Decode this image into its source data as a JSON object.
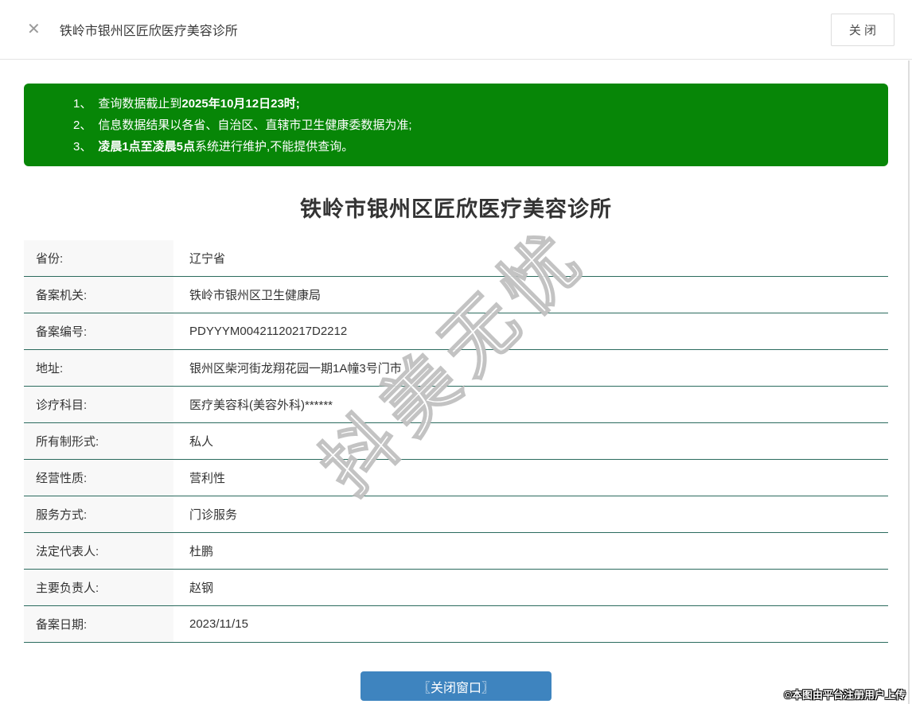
{
  "header": {
    "title": "铁岭市银州区匠欣医疗美容诊所",
    "close_button_label": "关 闭"
  },
  "icons": {
    "close_x": "✕"
  },
  "notice": {
    "line1_num": "1、",
    "line1_text": "查询数据截止到",
    "line1_bold": "2025年10月12日23时",
    "line1_end": ";",
    "line2_num": "2、",
    "line2_text": "信息数据结果以各省、自治区、直辖市卫生健康委数据为准;",
    "line3_num": "3、",
    "line3_bold": "凌晨1点至凌晨5点",
    "line3_text": "系统进行维护,不能提供查询。"
  },
  "main": {
    "title": "铁岭市银州区匠欣医疗美容诊所"
  },
  "table": {
    "rows": [
      {
        "label": "省份:",
        "value": "辽宁省"
      },
      {
        "label": "备案机关:",
        "value": "铁岭市银州区卫生健康局"
      },
      {
        "label": "备案编号:",
        "value": "PDYYYM00421120217D2212"
      },
      {
        "label": "地址:",
        "value": "银州区柴河街龙翔花园一期1A幢3号门市"
      },
      {
        "label": "诊疗科目:",
        "value": "医疗美容科(美容外科)******"
      },
      {
        "label": "所有制形式:",
        "value": "私人"
      },
      {
        "label": "经营性质:",
        "value": "营利性"
      },
      {
        "label": "服务方式:",
        "value": "门诊服务"
      },
      {
        "label": "法定代表人:",
        "value": "杜鹏"
      },
      {
        "label": "主要负责人:",
        "value": "赵钢"
      },
      {
        "label": "备案日期:",
        "value": "2023/11/15"
      }
    ]
  },
  "footer": {
    "close_window_label": "〖关闭窗口〗"
  },
  "watermark": {
    "diagonal": "抖美无忧",
    "copyright": "©本图由平台注册用户上传"
  },
  "colors": {
    "banner_green": "#078607",
    "row_border": "#2b6b5e",
    "button_blue": "#3e84bf",
    "label_bg": "#f8f8f8"
  }
}
